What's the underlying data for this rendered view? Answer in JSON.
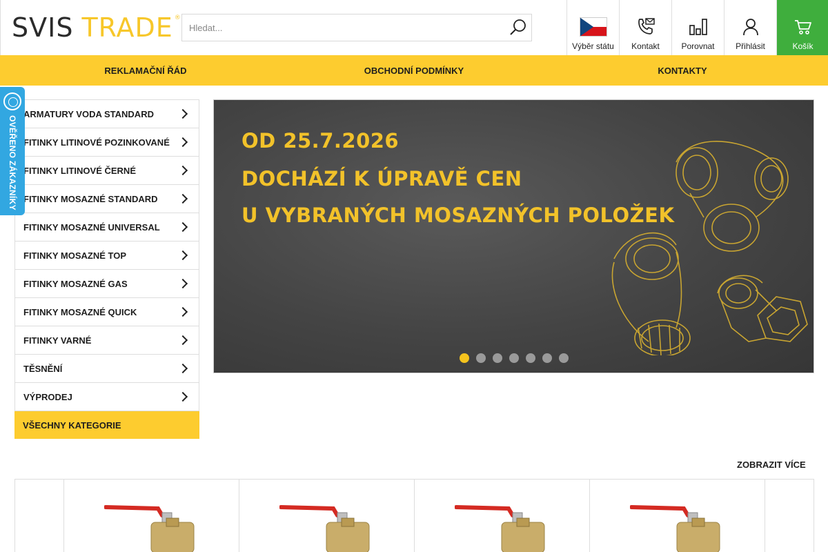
{
  "brand": {
    "name_part1": "SVIS",
    "name_part2": "TRADE",
    "registered": "®"
  },
  "search": {
    "placeholder": "Hledat..."
  },
  "header_nav": {
    "country": "Výběr státu",
    "contact": "Kontakt",
    "compare": "Porovnat",
    "login": "Přihlásit",
    "cart": "Košík"
  },
  "menu": [
    "REKLAMAČNÍ ŘÁD",
    "OBCHODNÍ PODMÍNKY",
    "KONTAKTY"
  ],
  "ribbon": {
    "label": "OVĚŘENO ZÁKAZNÍKY"
  },
  "categories": [
    "ARMATURY VODA STANDARD",
    "FITINKY LITINOVÉ POZINKOVANÉ",
    "FITINKY LITINOVÉ ČERNÉ",
    "FITINKY MOSAZNÉ STANDARD",
    "FITINKY MOSAZNÉ UNIVERSAL",
    "FITINKY MOSAZNÉ TOP",
    "FITINKY MOSAZNÉ GAS",
    "FITINKY MOSAZNÉ QUICK",
    "FITINKY VARNÉ",
    "TĚSNĚNÍ",
    "VÝPRODEJ"
  ],
  "all_categories": "VŠECHNY KATEGORIE",
  "banner": {
    "line1": "OD 25.7.2026",
    "line2": "DOCHÁZÍ K ÚPRAVĚ CEN",
    "line3": "U VYBRANÝCH MOSAZNÝCH POLOŽEK",
    "slide_count": 7,
    "active_slide": 1
  },
  "show_more": "ZOBRAZIT VÍCE",
  "colors": {
    "accent_yellow": "#fdcc2f",
    "cart_green": "#3fae3d",
    "ribbon_blue": "#32a7e1"
  }
}
